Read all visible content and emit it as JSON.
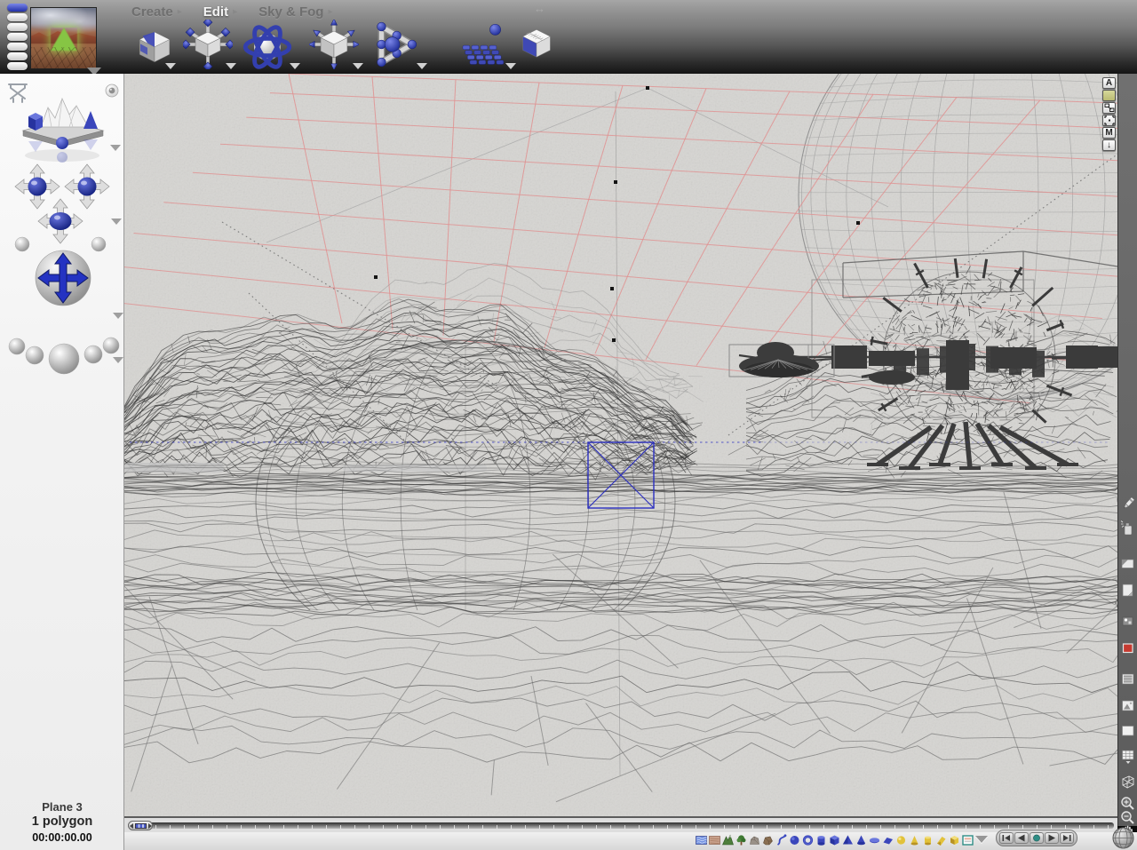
{
  "menu": {
    "arrow": "▸",
    "items": [
      {
        "label": "Create",
        "active": false
      },
      {
        "label": "Edit",
        "active": true
      },
      {
        "label": "Sky & Fog",
        "active": false
      }
    ]
  },
  "top_toolbar": {
    "resize_handle": "↔",
    "icons": [
      "edit-materials",
      "resize-tool",
      "rotate-tool",
      "reposition-tool",
      "edit-objects",
      "edit-terrain",
      "edit-mesh"
    ]
  },
  "sidebar": {
    "status": {
      "object_name": "Plane 3",
      "polygon_count": "1 polygon",
      "timecode": "00:00:00.00"
    }
  },
  "viewport": {
    "object_controls": [
      {
        "name": "attributes",
        "label": "A"
      },
      {
        "name": "family-color",
        "label": ""
      },
      {
        "name": "link",
        "label": ""
      },
      {
        "name": "origin-handle",
        "label": ""
      },
      {
        "name": "material",
        "label": "M"
      },
      {
        "name": "drop-arrow",
        "label": "↓"
      }
    ]
  },
  "create_palette": {
    "icons": [
      "water",
      "ground",
      "terrain",
      "tree",
      "rock",
      "stone",
      "path",
      "sphere",
      "torus",
      "cylinder",
      "cube",
      "pyramid",
      "cone",
      "disc",
      "plane",
      "light-sphere",
      "light-cone",
      "light-cylinder",
      "light-wedge",
      "light-cube",
      "picture-object"
    ]
  },
  "playback": {
    "buttons": [
      "step-back",
      "play-reverse",
      "stop",
      "play-forward",
      "step-forward"
    ]
  },
  "right_toolbar": {
    "icons": [
      "pencil",
      "spray",
      "render-region",
      "render-page",
      "render-options",
      "render-red",
      "texture-lines",
      "texture-image",
      "texture-plain",
      "plop-render",
      "wire-cube",
      "zoom-in",
      "zoom-out",
      "pan-hand"
    ]
  },
  "colors": {
    "selection_blue": "#2a2ec0",
    "wire_red": "#e09090",
    "accent_blue": "#3f49b5",
    "light_yellow": "#e2c23a",
    "teal_stop": "#2e8d85"
  }
}
